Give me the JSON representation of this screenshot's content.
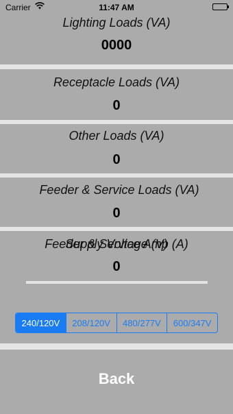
{
  "status_bar": {
    "carrier": "Carrier",
    "wifi_icon": "wifi-icon",
    "time": "11:47 AM",
    "battery_icon": "battery-icon"
  },
  "panels": [
    {
      "label": "Lighting Loads (VA)",
      "value": "0000"
    },
    {
      "label": "Receptacle Loads (VA)",
      "value": "0"
    },
    {
      "label": "Other Loads (VA)",
      "value": "0"
    },
    {
      "label": "Feeder & Service Loads (VA)",
      "value": "0"
    },
    {
      "label": "Feeder & Service Amp (A)",
      "value": "0"
    }
  ],
  "supply_voltage": {
    "label": "Supply Voltage (V)",
    "options": [
      "240/120V",
      "208/120V",
      "480/277V",
      "600/347V"
    ],
    "selected": "240/120V"
  },
  "back_label": "Back",
  "colors": {
    "panel_bg": "#ababab",
    "page_bg": "#e4e4e4",
    "accent": "#1a7cf5",
    "button_text": "#ffffff"
  }
}
